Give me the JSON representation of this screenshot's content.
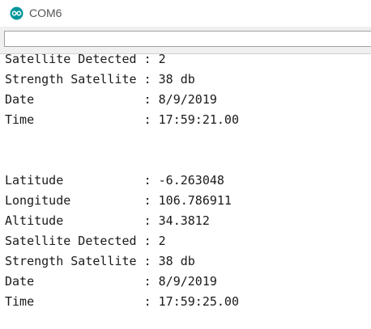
{
  "window": {
    "title": "COM6"
  },
  "send": {
    "value": ""
  },
  "serial_output": [
    "Satellite Detected : 2",
    "Strength Satellite : 38 db",
    "Date               : 8/9/2019",
    "Time               : 17:59:21.00",
    "",
    "",
    "Latitude           : -6.263048",
    "Longitude          : 106.786911",
    "Altitude           : 34.3812",
    "Satellite Detected : 2",
    "Strength Satellite : 38 db",
    "Date               : 8/9/2019",
    "Time               : 17:59:25.00"
  ],
  "colors": {
    "icon": "#00979c",
    "title_text": "#555555",
    "output_text": "#1a1a1a"
  }
}
